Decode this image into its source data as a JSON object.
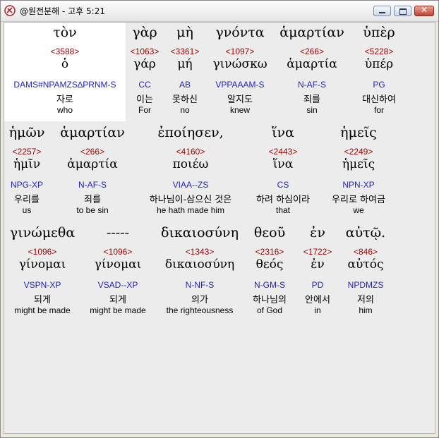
{
  "window": {
    "title": "@원전분해 - 고후 5:21",
    "app_icon": "app-logo-icon",
    "controls": {
      "minimize": "minimize-icon",
      "maximize": "maximize-icon",
      "close": "close-icon"
    }
  },
  "colors": {
    "strong": "#9b0000",
    "parse": "#1f1fbd",
    "selected_bg": "#ffffff"
  },
  "words": [
    {
      "greek": "τὸν",
      "strong": "<3588>",
      "lemma": "ὁ",
      "parse": "DAMS#NPAMZS∆PRNM-S",
      "korean": "자로",
      "english": "who"
    },
    {
      "greek": "γὰρ",
      "strong": "<1063>",
      "lemma": "γάρ",
      "parse": "CC",
      "korean": "이는",
      "english": "For"
    },
    {
      "greek": "μὴ",
      "strong": "<3361>",
      "lemma": "μή",
      "parse": "AB",
      "korean": "못하신",
      "english": "no"
    },
    {
      "greek": "γνόντα",
      "strong": "<1097>",
      "lemma": "γινώσκω",
      "parse": "VPPAAAM-S",
      "korean": "알지도",
      "english": "knew"
    },
    {
      "greek": "ἁμαρτίαν",
      "strong": "<266>",
      "lemma": "ἁμαρτία",
      "parse": "N-AF-S",
      "korean": "죄를",
      "english": "sin"
    },
    {
      "greek": "ὑπὲρ",
      "strong": "<5228>",
      "lemma": "ὑπέρ",
      "parse": "PG",
      "korean": "대신하여",
      "english": "for"
    },
    {
      "greek": "ἡμῶν",
      "strong": "<2257>",
      "lemma": "ἡμῖν",
      "parse": "NPG-XP",
      "korean": "우리를",
      "english": "us"
    },
    {
      "greek": "ἁμαρτίαν",
      "strong": "<266>",
      "lemma": "ἁμαρτία",
      "parse": "N-AF-S",
      "korean": "죄를",
      "english": "to be sin"
    },
    {
      "greek": "ἐποίησεν,",
      "strong": "<4160>",
      "lemma": "ποιέω",
      "parse": "VIAA--ZS",
      "korean": "하나님이-삼으신 것은",
      "english": "he hath made him"
    },
    {
      "greek": "ἵνα",
      "strong": "<2443>",
      "lemma": "ἵνα",
      "parse": "CS",
      "korean": "하려 하심이라",
      "english": "that"
    },
    {
      "greek": "ἡμεῖς",
      "strong": "<2249>",
      "lemma": "ἡμεῖς",
      "parse": "NPN-XP",
      "korean": "우리로 하여금",
      "english": "we"
    },
    {
      "greek": "γινώμεθα",
      "strong": "<1096>",
      "lemma": "γίνομαι",
      "parse": "VSPN-XP",
      "korean": "되게",
      "english": "might be made"
    },
    {
      "greek": "-----",
      "strong": "<1096>",
      "lemma": "γίνομαι",
      "parse": "VSAD--XP",
      "korean": "되게",
      "english": "might be made"
    },
    {
      "greek": "δικαιοσύνη",
      "strong": "<1343>",
      "lemma": "δικαιοσύνη",
      "parse": "N-NF-S",
      "korean": "의가",
      "english": "the righteousness"
    },
    {
      "greek": "θεοῦ",
      "strong": "<2316>",
      "lemma": "θεός",
      "parse": "N-GM-S",
      "korean": "하나님의",
      "english": "of God"
    },
    {
      "greek": "ἐν",
      "strong": "<1722>",
      "lemma": "ἐν",
      "parse": "PD",
      "korean": "안에서",
      "english": "in"
    },
    {
      "greek": "αὐτῷ.",
      "strong": "<846>",
      "lemma": "αὐτός",
      "parse": "NPDMZS",
      "korean": "저의",
      "english": "him"
    }
  ]
}
